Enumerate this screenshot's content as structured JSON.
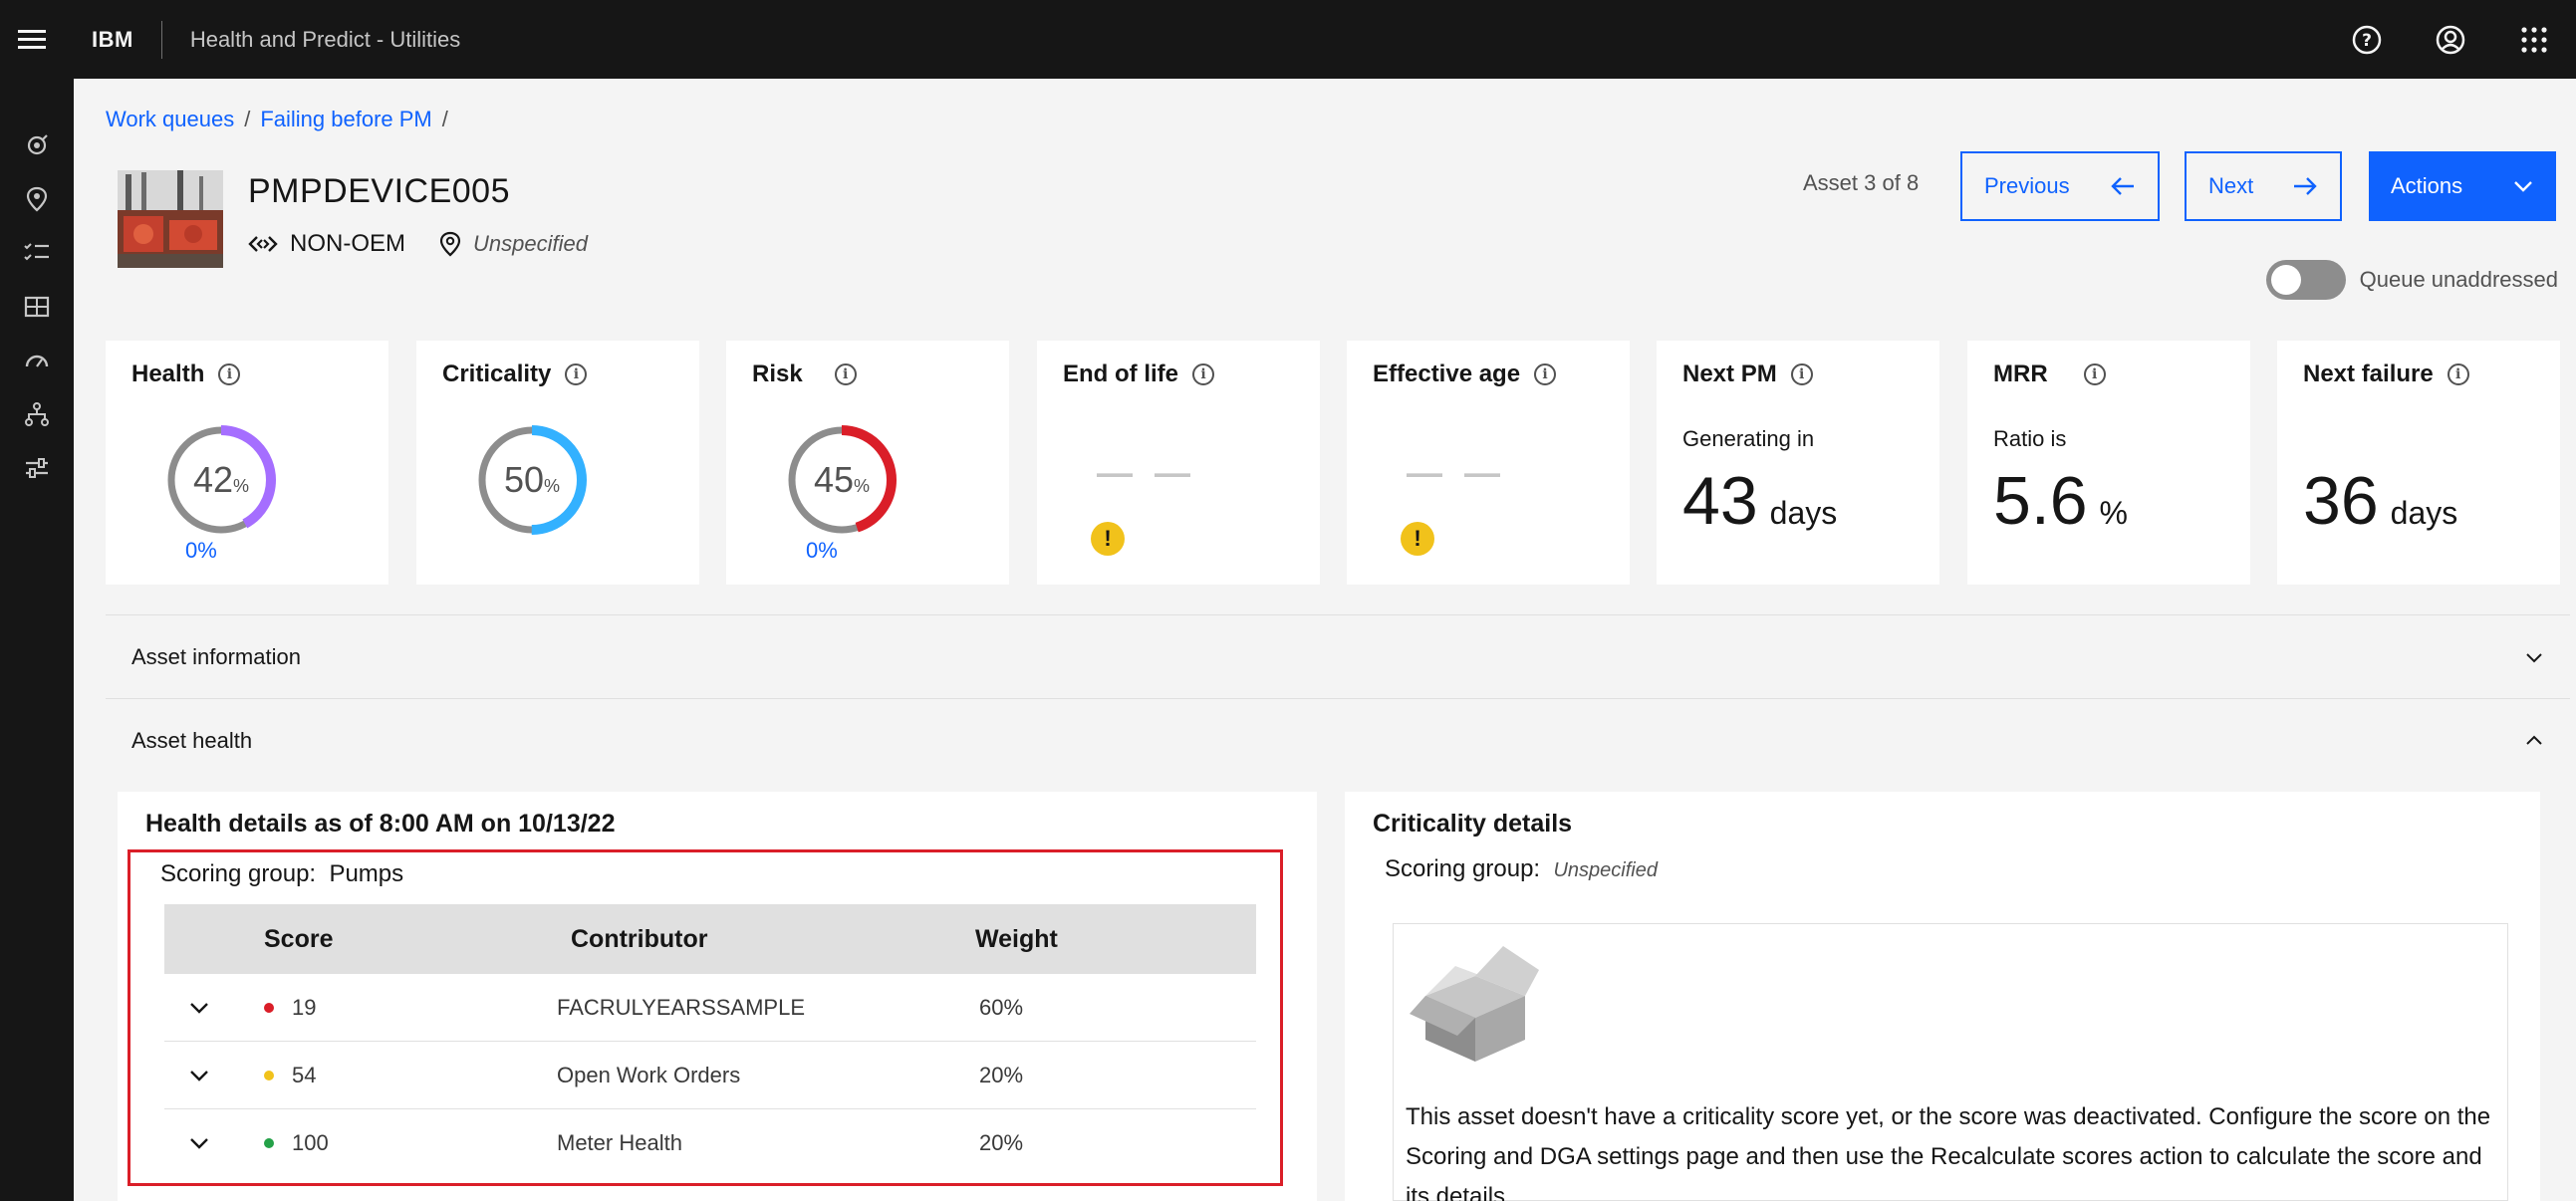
{
  "header": {
    "brand": "IBM",
    "app_name": "Health and Predict - Utilities"
  },
  "breadcrumb": {
    "items": [
      "Work queues",
      "Failing before PM"
    ],
    "separator": "/"
  },
  "asset": {
    "id": "PMPDEVICE005",
    "type": "NON-OEM",
    "location": "Unspecified"
  },
  "nav": {
    "position": "Asset 3 of 8",
    "previous_label": "Previous",
    "next_label": "Next",
    "actions_label": "Actions",
    "queue_toggle_label": "Queue unaddressed"
  },
  "cards": {
    "health": {
      "title": "Health",
      "value": "42",
      "unit": "%",
      "sub": "0%",
      "percent": 42,
      "color": "#a56eff"
    },
    "criticality": {
      "title": "Criticality",
      "value": "50",
      "unit": "%",
      "percent": 50,
      "color": "#33b1ff"
    },
    "risk": {
      "title": "Risk",
      "value": "45",
      "unit": "%",
      "sub": "0%",
      "percent": 45,
      "color": "#da1e28"
    },
    "end_of_life": {
      "title": "End of life",
      "placeholder": "— —",
      "warning": "!"
    },
    "effective_age": {
      "title": "Effective age",
      "placeholder": "— —",
      "warning": "!"
    },
    "next_pm": {
      "title": "Next PM",
      "sub": "Generating in",
      "value": "43",
      "unit": "days"
    },
    "mrr": {
      "title": "MRR",
      "sub": "Ratio is",
      "value": "5.6",
      "unit": "%"
    },
    "next_failure": {
      "title": "Next failure",
      "value": "36",
      "unit": "days"
    }
  },
  "sections": {
    "asset_information": "Asset information",
    "asset_health": "Asset health"
  },
  "health_details": {
    "title": "Health details as of 8:00 AM on 10/13/22",
    "scoring_label": "Scoring group:",
    "scoring_value": "Pumps",
    "columns": [
      "Score",
      "Contributor",
      "Weight"
    ],
    "rows": [
      {
        "score": "19",
        "contributor": "FACRULYEARSSAMPLE",
        "weight": "60%",
        "color": "#da1e28"
      },
      {
        "score": "54",
        "contributor": "Open Work Orders",
        "weight": "20%",
        "color": "#f1c21b"
      },
      {
        "score": "100",
        "contributor": "Meter Health",
        "weight": "20%",
        "color": "#24a148"
      }
    ]
  },
  "criticality_details": {
    "title": "Criticality details",
    "scoring_label": "Scoring group:",
    "scoring_value": "Unspecified",
    "message": "This asset doesn't have a criticality score yet, or the score was deactivated. Configure the score on the Scoring and DGA settings page and then use the Recalculate scores action to calculate the score and its details."
  }
}
